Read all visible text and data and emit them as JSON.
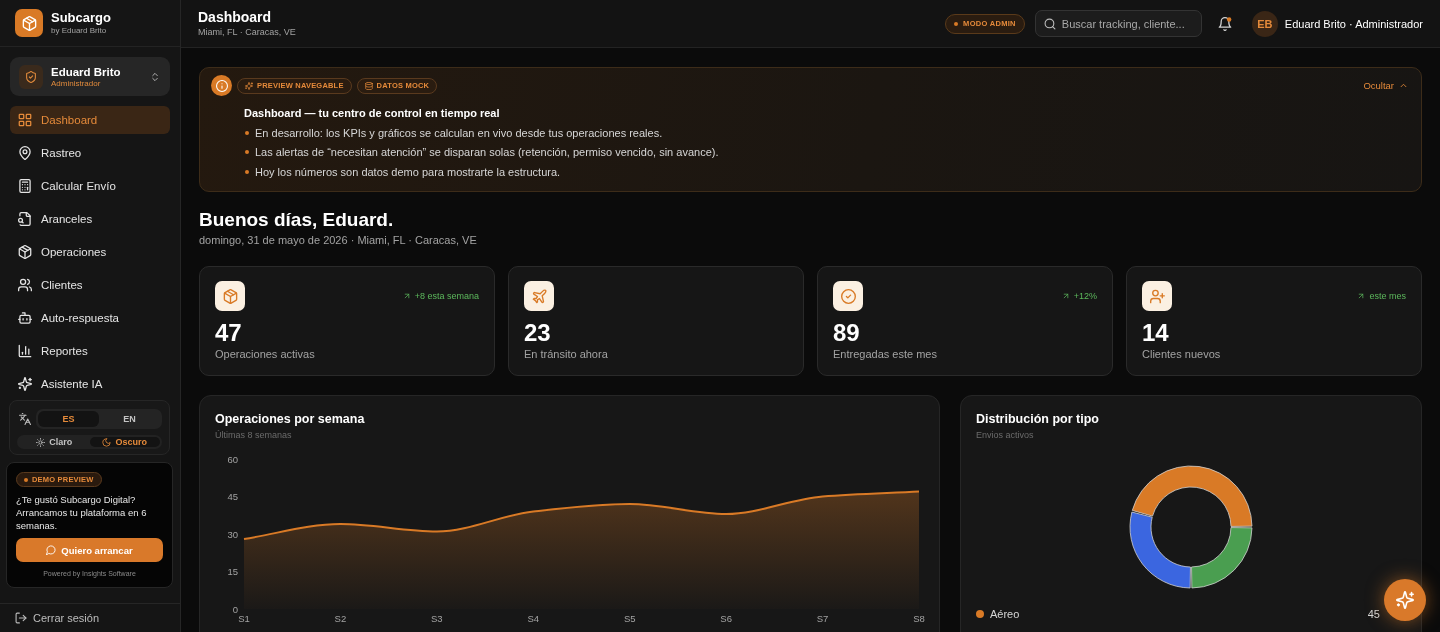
{
  "sidebar": {
    "brand": {
      "name": "Subcargo",
      "tagline": "by Eduard Brito"
    },
    "user": {
      "name": "Eduard Brito",
      "role": "Administrador"
    },
    "nav": [
      {
        "label": "Dashboard",
        "selected": true
      },
      {
        "label": "Rastreo",
        "selected": false
      },
      {
        "label": "Calcular Envío",
        "selected": false
      },
      {
        "label": "Aranceles",
        "selected": false
      },
      {
        "label": "Operaciones",
        "selected": false
      },
      {
        "label": "Clientes",
        "selected": false
      },
      {
        "label": "Auto-respuesta",
        "selected": false
      },
      {
        "label": "Reportes",
        "selected": false
      },
      {
        "label": "Asistente IA",
        "selected": false
      }
    ],
    "language": {
      "options": [
        {
          "label": "ES",
          "selected": true
        },
        {
          "label": "EN",
          "selected": false
        }
      ]
    },
    "theme": {
      "options": [
        {
          "label": "Claro",
          "selected": false
        },
        {
          "label": "Oscuro",
          "selected": true
        }
      ]
    },
    "promo": {
      "badge": "DEMO PREVIEW",
      "text": "¿Te gustó Subcargo Digital? Arrancamos tu plataforma en 6 semanas.",
      "button": "Quiero arrancar",
      "footer": "Powered by Insights Software"
    },
    "logout": "Cerrar sesión"
  },
  "header": {
    "title": "Dashboard",
    "subtitle": "Miami, FL · Caracas, VE",
    "mode_badge": "MODO ADMIN",
    "search": {
      "placeholder": "Buscar tracking, cliente..."
    },
    "notifications": {
      "unread": true
    },
    "user": {
      "initials": "EB",
      "label": "Eduard Brito · Administrador"
    }
  },
  "banner": {
    "tags": [
      "PREVIEW NAVEGABLE",
      "DATOS MOCK"
    ],
    "hide_link": "Ocultar",
    "title": "Dashboard — tu centro de control en tiempo real",
    "bullets": [
      "En desarrollo: los KPIs y gráficos se calculan en vivo desde tus operaciones reales.",
      "Las alertas de “necesitan atención” se disparan solas (retención, permiso vencido, sin avance).",
      "Hoy los números son datos demo para mostrarte la estructura."
    ]
  },
  "greeting": {
    "title": "Buenos días, Eduard.",
    "subtitle": "domingo, 31 de mayo de 2026 · Miami, FL · Caracas, VE"
  },
  "kpis": [
    {
      "value": "47",
      "label": "Operaciones activas",
      "trend": "+8 esta semana"
    },
    {
      "value": "23",
      "label": "En tránsito ahora"
    },
    {
      "value": "89",
      "label": "Entregadas este mes",
      "trend": "+12%"
    },
    {
      "value": "14",
      "label": "Clientes nuevos",
      "trend": "este mes"
    }
  ],
  "weekly_chart": {
    "title": "Operaciones por semana",
    "subtitle": "Últimas 8 semanas",
    "chart_data": {
      "type": "area",
      "categories": [
        "S1",
        "S2",
        "S3",
        "S4",
        "S5",
        "S6",
        "S7",
        "S8"
      ],
      "values": [
        28,
        34,
        31,
        39,
        42,
        38,
        45,
        47
      ],
      "ylim": [
        0,
        60
      ],
      "yticks": [
        0,
        15,
        30,
        45,
        60
      ]
    }
  },
  "type_chart": {
    "title": "Distribución por tipo",
    "subtitle": "Envios activos",
    "legend": [
      {
        "label": "Aéreo",
        "value": "45",
        "color": "#d97a26"
      }
    ]
  }
}
